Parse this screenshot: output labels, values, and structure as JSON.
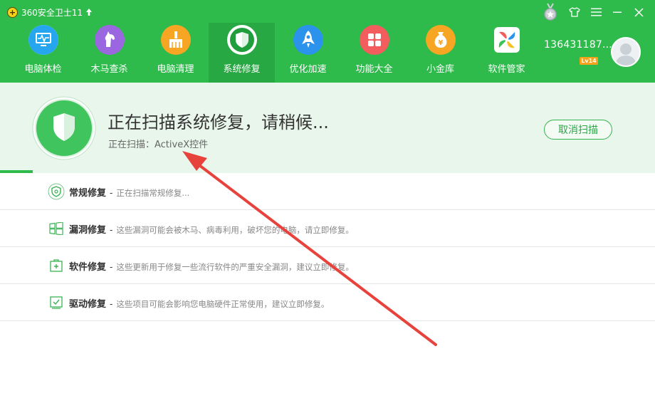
{
  "app": {
    "title": "360安全卫士11",
    "logo_glyph": "+",
    "accent_color": "#2fba4c"
  },
  "window_controls": [
    {
      "name": "medal-icon"
    },
    {
      "name": "skin-icon"
    },
    {
      "name": "menu-icon"
    },
    {
      "name": "minimize-icon"
    },
    {
      "name": "close-icon"
    }
  ],
  "nav": {
    "items": [
      {
        "label": "电脑体检",
        "icon": "monitor-check-icon",
        "color": "#1fa0e9"
      },
      {
        "label": "木马查杀",
        "icon": "trojan-horse-icon",
        "color": "#8a5fd6"
      },
      {
        "label": "电脑清理",
        "icon": "broom-icon",
        "color": "#f5a11b"
      },
      {
        "label": "系统修复",
        "icon": "shield-icon",
        "color": "#ffffff",
        "active": true
      },
      {
        "label": "优化加速",
        "icon": "rocket-icon",
        "color": "#1f8fe6"
      },
      {
        "label": "功能大全",
        "icon": "grid-icon",
        "color": "#f25a5a"
      },
      {
        "label": "小金库",
        "icon": "money-bag-icon",
        "color": "#f5a11b"
      },
      {
        "label": "软件管家",
        "icon": "software-store-icon",
        "color": "#ffffff"
      }
    ]
  },
  "user": {
    "id": "136431187...",
    "level": "Lv14"
  },
  "scan": {
    "title": "正在扫描系统修复，请稍候...",
    "current": "正在扫描：ActiveX控件",
    "cancel_label": "取消扫描",
    "progress_percent": 5
  },
  "repairs": [
    {
      "name": "常规修复",
      "separator": "-",
      "desc": "正在扫描常规修复...",
      "icon": "shield-outline-icon"
    },
    {
      "name": "漏洞修复",
      "separator": "-",
      "desc": "这些漏洞可能会被木马、病毒利用，破坏您的电脑，请立即修复。",
      "icon": "windows-icon"
    },
    {
      "name": "软件修复",
      "separator": "-",
      "desc": "这些更新用于修复一些流行软件的严重安全漏洞，建议立即修复。",
      "icon": "software-patch-icon"
    },
    {
      "name": "驱动修复",
      "separator": "-",
      "desc": "这些项目可能会影响您电脑硬件正常使用，建议立即修复。",
      "icon": "driver-icon"
    }
  ]
}
